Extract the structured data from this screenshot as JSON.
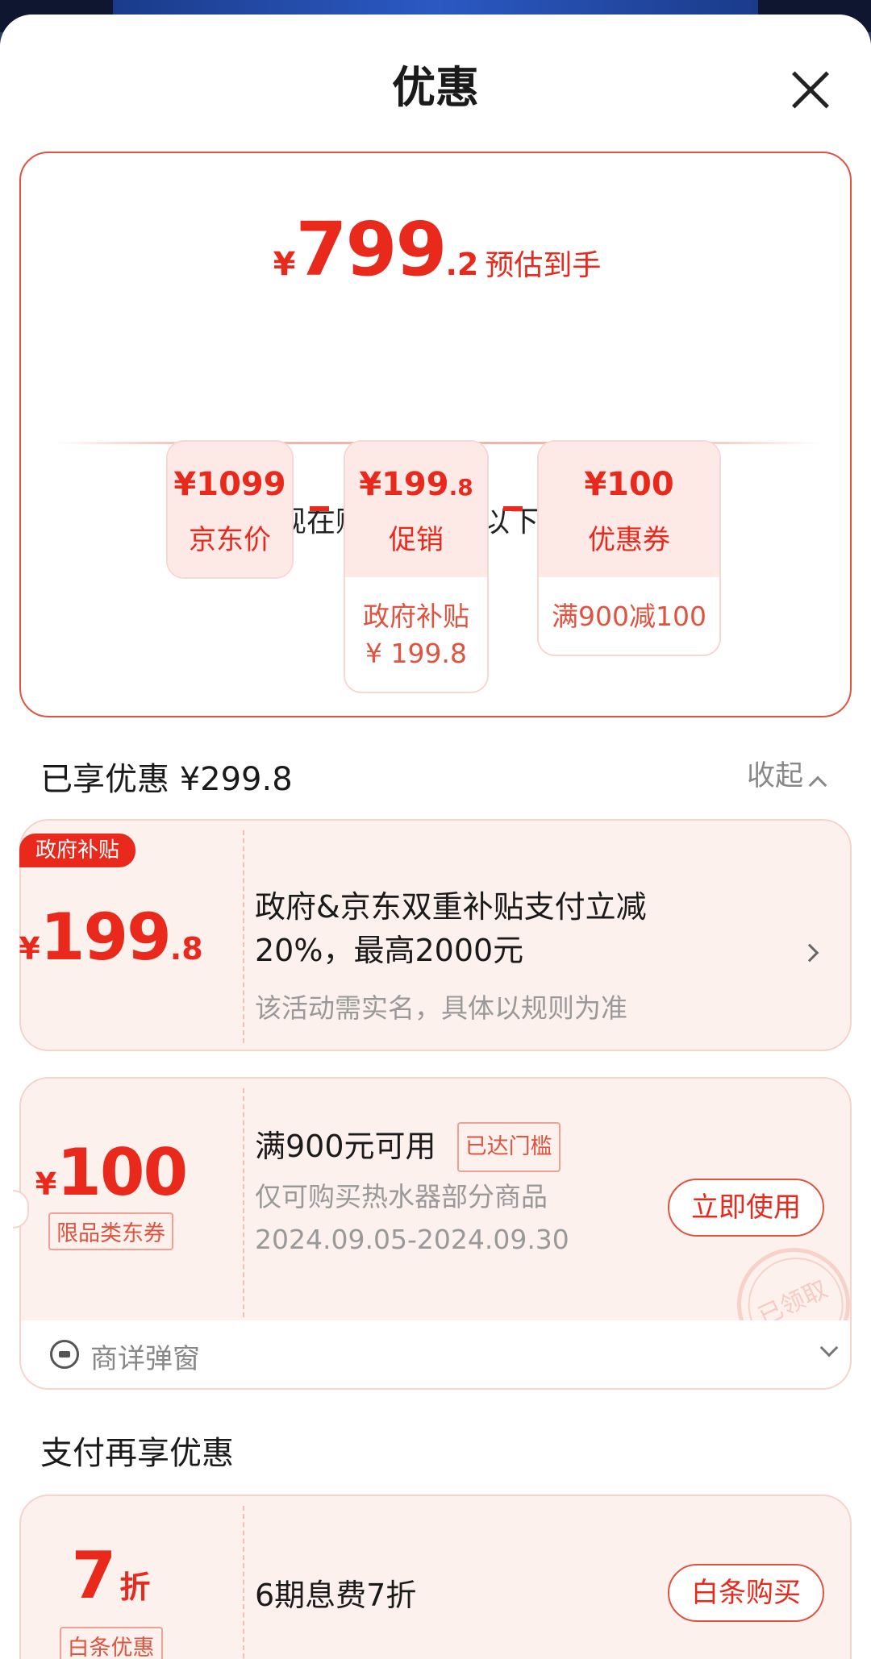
{
  "sheet": {
    "title": "优惠"
  },
  "estimate": {
    "currency": "¥",
    "integer": "799",
    "decimal": ".2",
    "label": "预估到手"
  },
  "summary": {
    "intro": "现在购买，享受以下优惠",
    "boxes": [
      {
        "amount": "¥1099",
        "amount_decimal": "",
        "name": "京东价",
        "detail": ""
      },
      {
        "amount": "¥199",
        "amount_decimal": ".8",
        "name": "促销",
        "detail": "政府补贴\n¥ 199.8"
      },
      {
        "amount": "¥100",
        "amount_decimal": "",
        "name": "优惠券",
        "detail": "满900减100"
      }
    ],
    "operators": [
      "-",
      "-"
    ]
  },
  "enjoyed": {
    "title": "已享优惠 ¥299.8",
    "toggle": "收起"
  },
  "gov_card": {
    "tag": "政府补贴",
    "currency": "¥",
    "integer": "199",
    "decimal": ".8",
    "title": "政府&京东双重补贴支付立减20%，最高2000元",
    "subtitle": "该活动需实名，具体以规则为准"
  },
  "coupon_card": {
    "currency": "¥",
    "amount": "100",
    "type_badge": "限品类东券",
    "condition": "满900元可用",
    "status_badge": "已达门槛",
    "scope": "仅可购买热水器部分商品",
    "validity": "2024.09.05-2024.09.30",
    "button": "立即使用",
    "stamp": "已领取",
    "footer": "商详弹窗"
  },
  "pay_section": {
    "title": "支付再享优惠",
    "discount_value": "7",
    "discount_unit": "折",
    "badge": "白条优惠",
    "text": "6期息费7折",
    "button": "白条购买"
  },
  "colors": {
    "accent": "#e8291c",
    "card_bg": "#fdf1ee",
    "border": "#f6d4cd"
  }
}
